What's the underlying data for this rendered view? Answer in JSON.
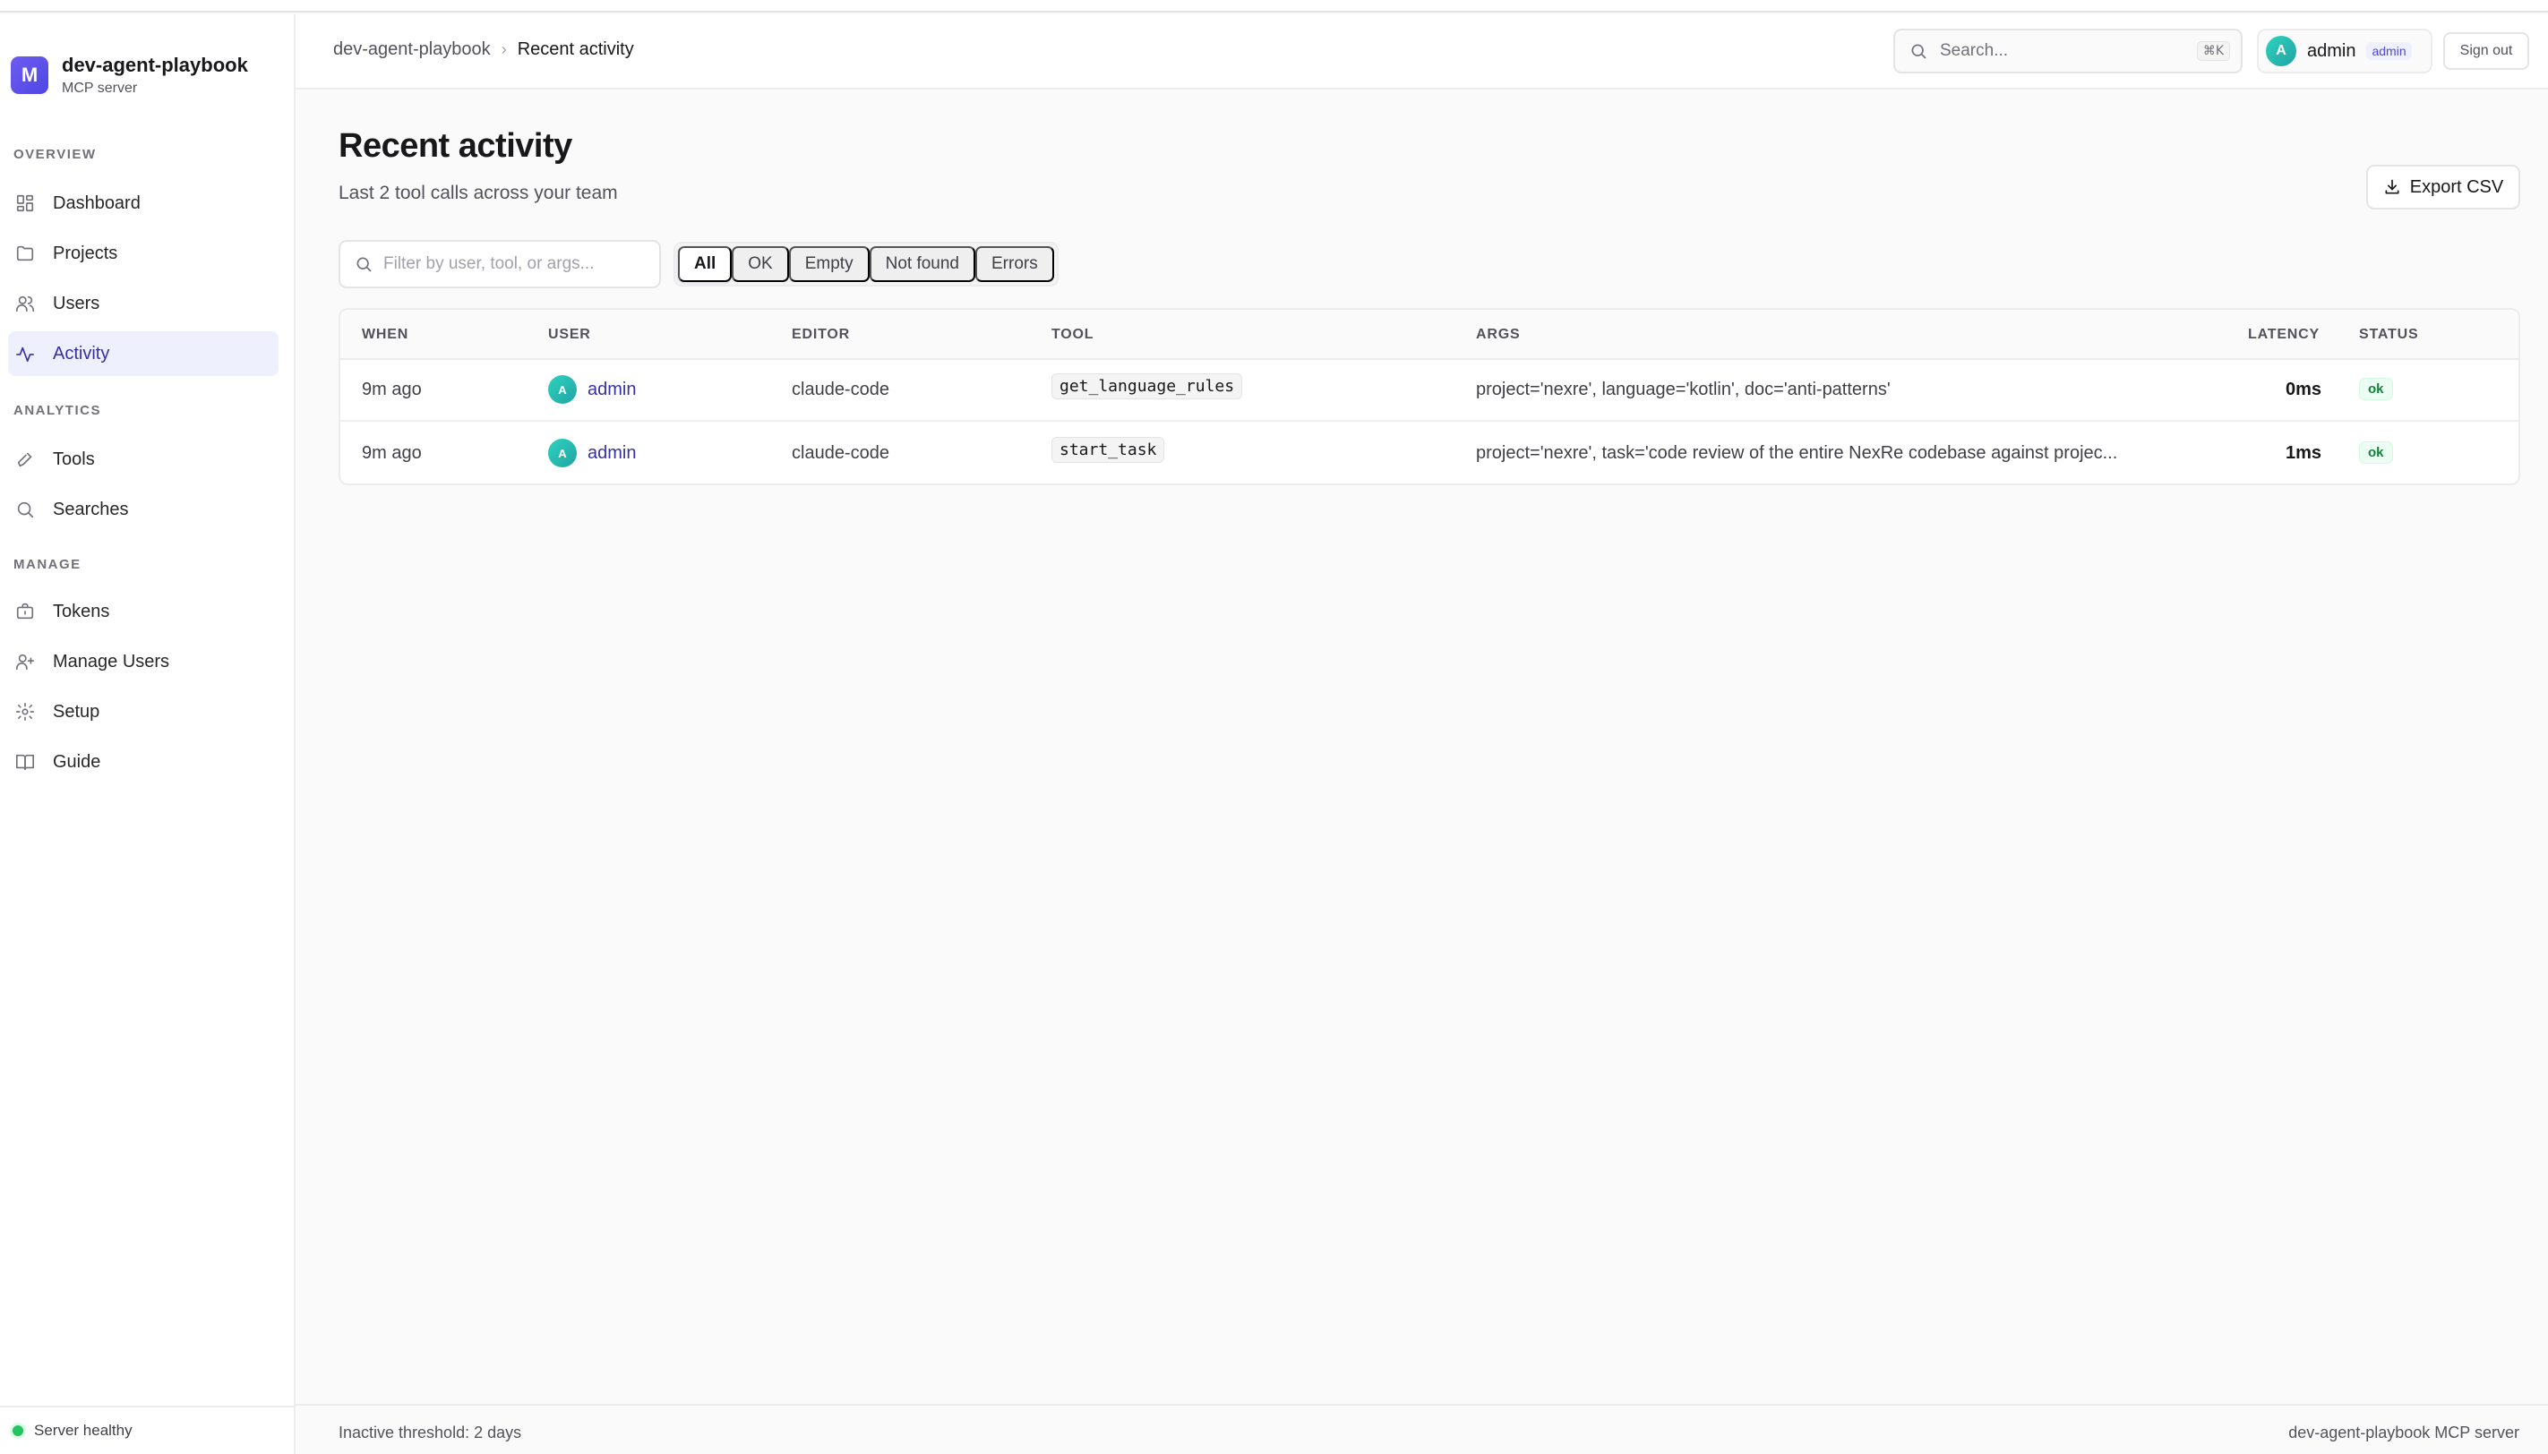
{
  "brand": {
    "logo_letter": "M",
    "name": "dev-agent-playbook",
    "subtitle": "MCP server"
  },
  "sidebar": {
    "sections": [
      {
        "label": "OVERVIEW"
      },
      {
        "label": "ANALYTICS"
      },
      {
        "label": "MANAGE"
      }
    ],
    "items": [
      {
        "label": "Dashboard",
        "icon": "dashboard-icon"
      },
      {
        "label": "Projects",
        "icon": "folder-icon"
      },
      {
        "label": "Users",
        "icon": "users-icon"
      },
      {
        "label": "Activity",
        "icon": "activity-icon",
        "active": true
      },
      {
        "label": "Tools",
        "icon": "wrench-icon"
      },
      {
        "label": "Searches",
        "icon": "search-icon"
      },
      {
        "label": "Tokens",
        "icon": "briefcase-icon"
      },
      {
        "label": "Manage Users",
        "icon": "user-plus-icon"
      },
      {
        "label": "Setup",
        "icon": "gear-icon"
      },
      {
        "label": "Guide",
        "icon": "book-icon"
      }
    ],
    "footer_status": "Server healthy",
    "status_color": "#22c55e"
  },
  "header": {
    "breadcrumb": {
      "root": "dev-agent-playbook",
      "separator": "›",
      "current": "Recent activity"
    },
    "search": {
      "placeholder": "Search...",
      "shortcut": "⌘K"
    },
    "user": {
      "avatar_letter": "A",
      "name": "admin",
      "role": "admin"
    },
    "signout_label": "Sign out"
  },
  "main": {
    "title": "Recent activity",
    "subtitle": "Last 2 tool calls across your team",
    "export_label": "Export CSV",
    "filter": {
      "placeholder": "Filter by user, tool, or args...",
      "value": ""
    },
    "segments": [
      "All",
      "OK",
      "Empty",
      "Not found",
      "Errors"
    ],
    "active_segment": "All",
    "table": {
      "columns": [
        "WHEN",
        "USER",
        "EDITOR",
        "TOOL",
        "ARGS",
        "LATENCY",
        "STATUS"
      ],
      "rows": [
        {
          "when": "9m ago",
          "user_initial": "A",
          "user": "admin",
          "editor": "claude-code",
          "tool": "get_language_rules",
          "args": "project='nexre', language='kotlin', doc='anti-patterns'",
          "latency": "0ms",
          "status": "ok"
        },
        {
          "when": "9m ago",
          "user_initial": "A",
          "user": "admin",
          "editor": "claude-code",
          "tool": "start_task",
          "args": "project='nexre', task='code review of the entire NexRe codebase against projec...",
          "latency": "1ms",
          "status": "ok"
        }
      ]
    }
  },
  "footer": {
    "left": "Inactive threshold: 2 days",
    "right": "dev-agent-playbook MCP server"
  },
  "colors": {
    "accent": "#4f46e5",
    "active_bg": "#eef0fd",
    "ok": "#15803d"
  }
}
